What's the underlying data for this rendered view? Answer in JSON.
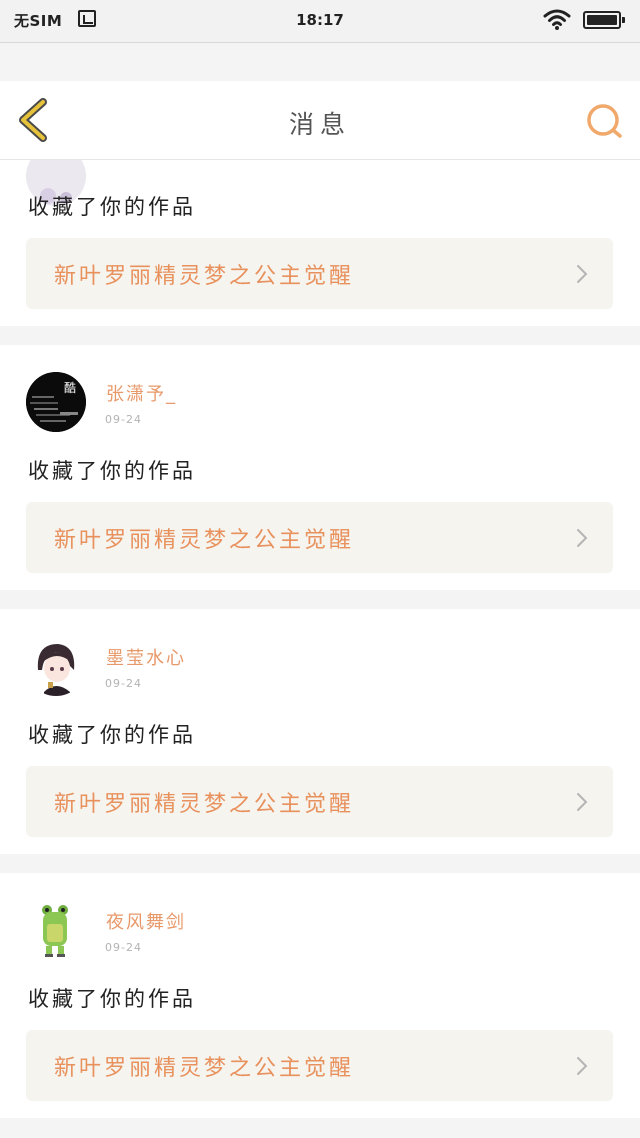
{
  "status_bar": {
    "carrier": "无SIM",
    "time": "18:17"
  },
  "header": {
    "title": "消息"
  },
  "colors": {
    "accent": "#e8996a",
    "box_bg": "#f5f4ef",
    "back_arrow": "#e6c13a",
    "search": "#f0a86b"
  },
  "messages": [
    {
      "user": "",
      "date": "",
      "action": "收藏了你的作品",
      "work": "新叶罗丽精灵梦之公主觉醒"
    },
    {
      "user": "张潇予_",
      "date": "09-24",
      "action": "收藏了你的作品",
      "work": "新叶罗丽精灵梦之公主觉醒",
      "avatar_text": "酷"
    },
    {
      "user": "墨莹水心",
      "date": "09-24",
      "action": "收藏了你的作品",
      "work": "新叶罗丽精灵梦之公主觉醒"
    },
    {
      "user": "夜风舞剑",
      "date": "09-24",
      "action": "收藏了你的作品",
      "work": "新叶罗丽精灵梦之公主觉醒"
    }
  ]
}
